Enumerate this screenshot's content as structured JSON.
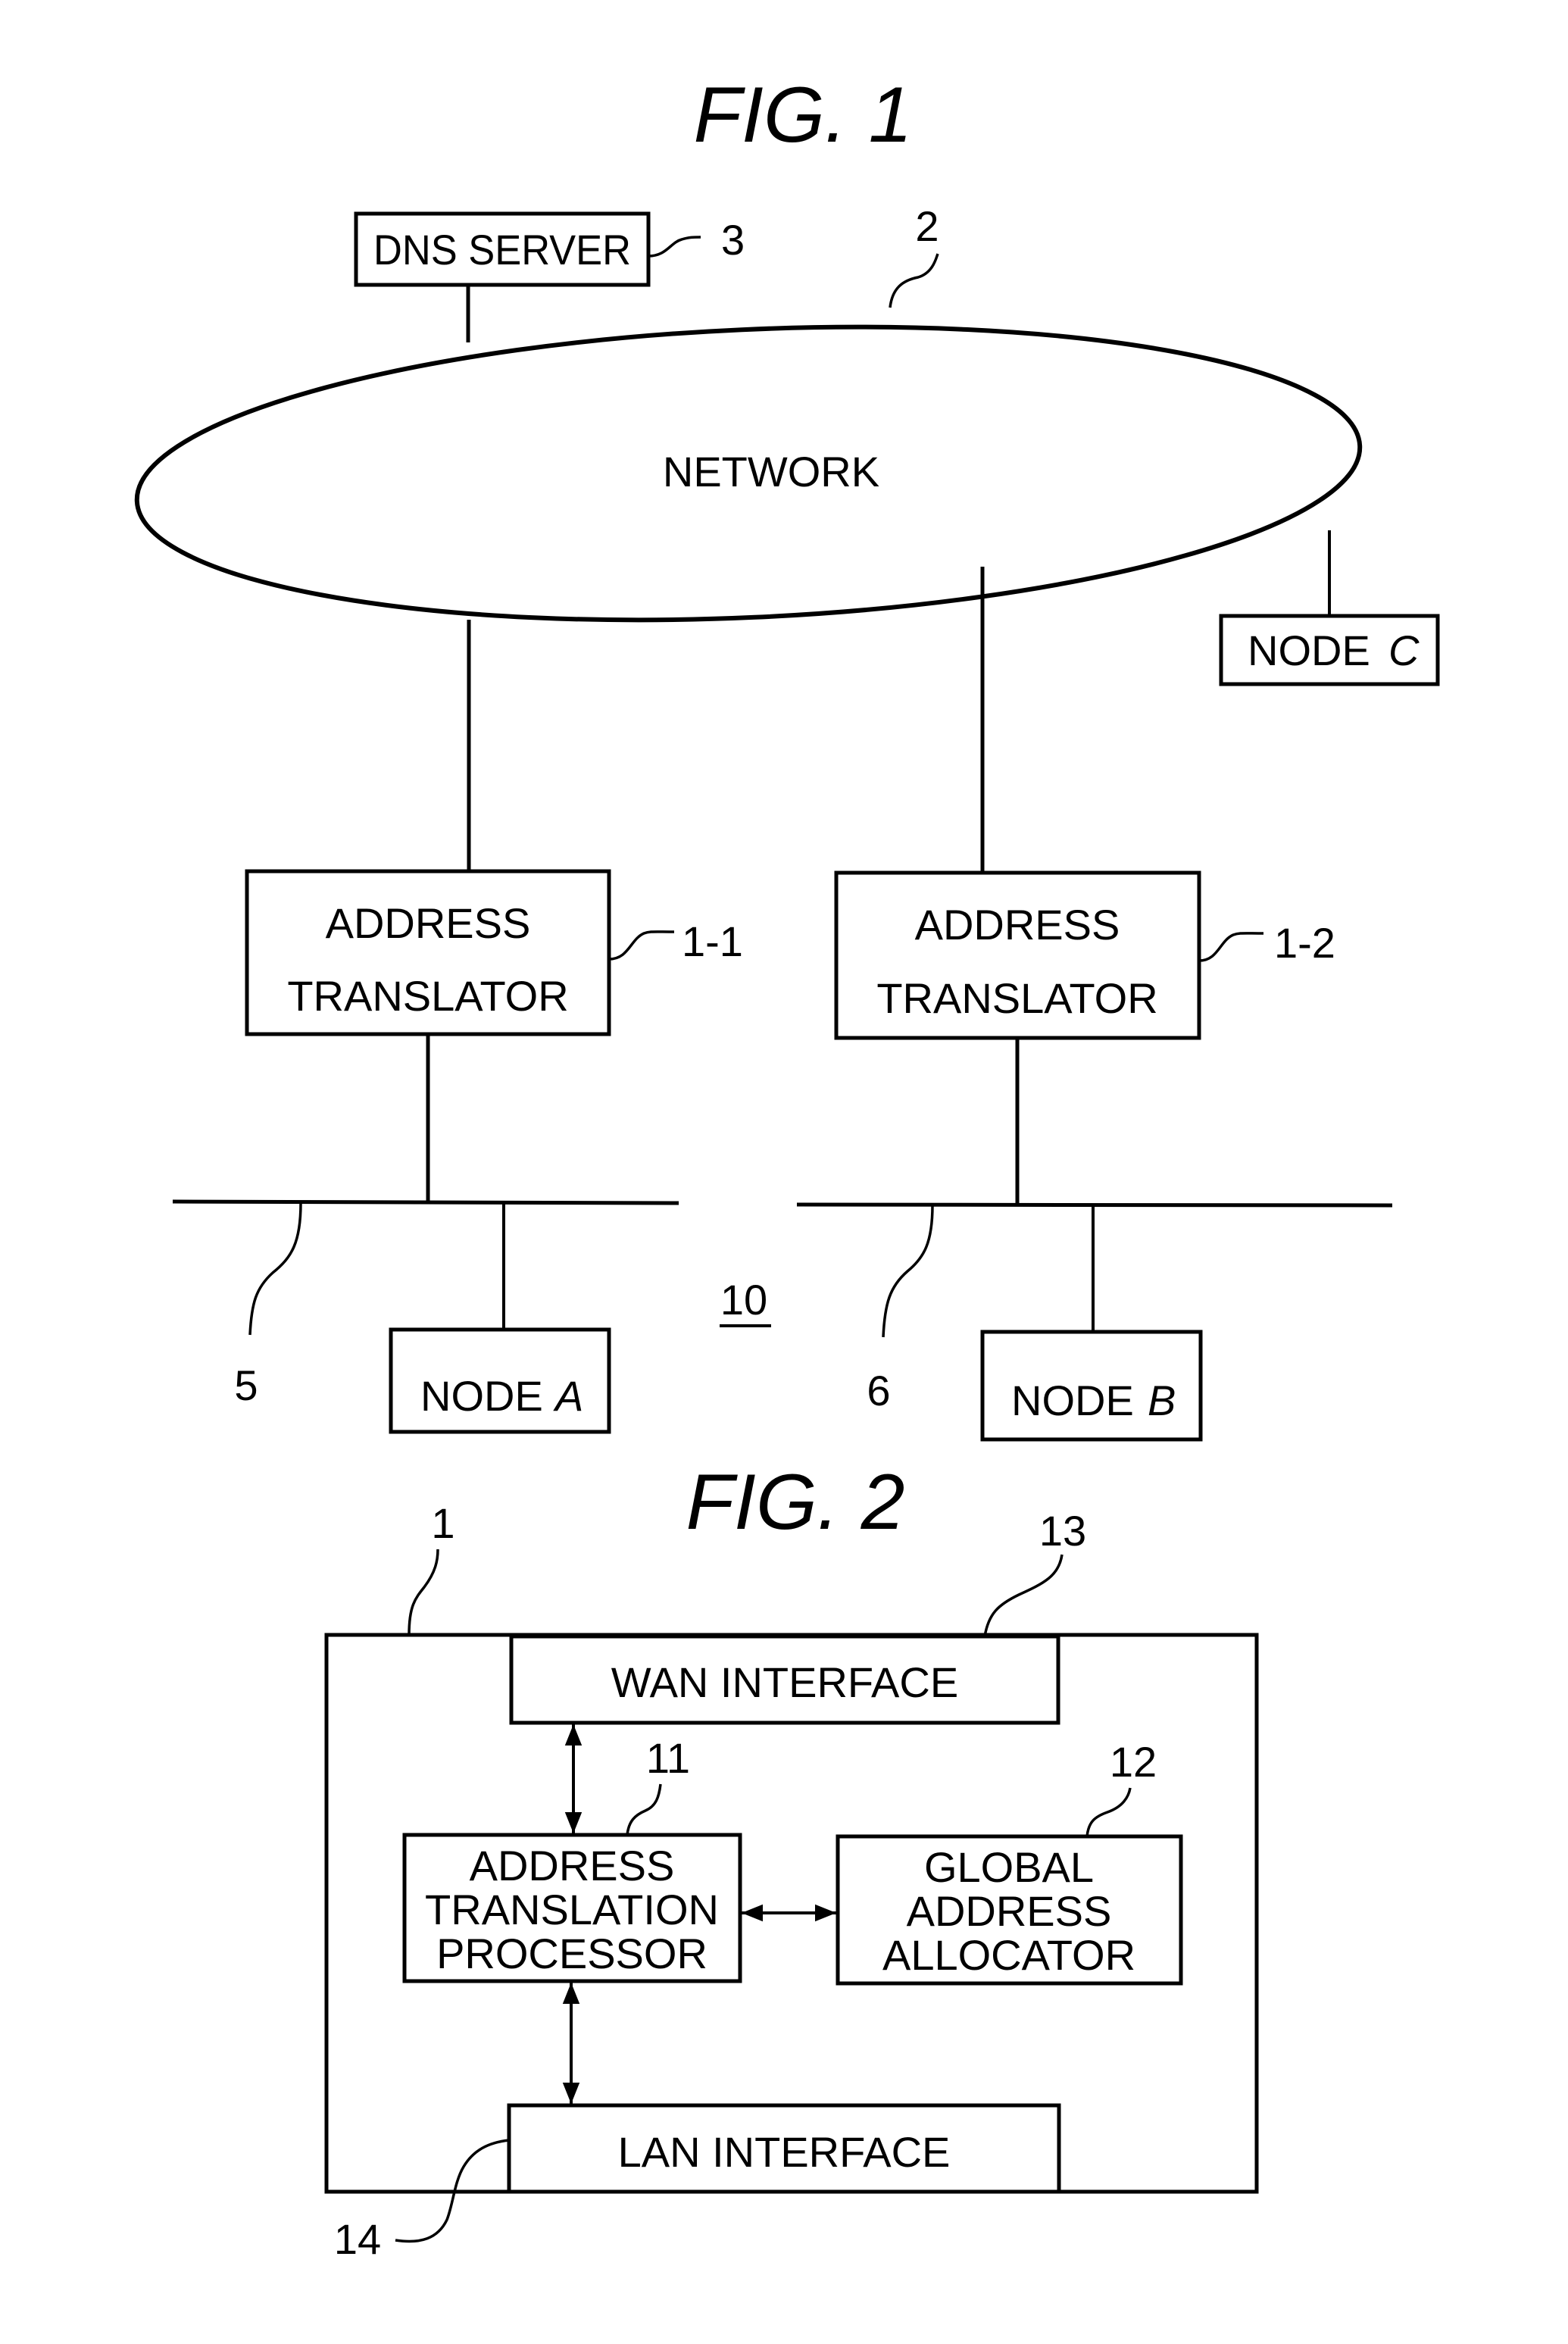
{
  "figure1": {
    "title": "FIG. 1",
    "system_ref": "10",
    "network": {
      "label": "NETWORK",
      "ref": "2"
    },
    "dns_server": {
      "label": "DNS SERVER",
      "ref": "3"
    },
    "node_c": {
      "label": "NODE",
      "letter": "C"
    },
    "translator_1": {
      "line1": "ADDRESS",
      "line2": "TRANSLATOR",
      "ref": "1-1"
    },
    "translator_2": {
      "line1": "ADDRESS",
      "line2": "TRANSLATOR",
      "ref": "1-2"
    },
    "lan_1": {
      "ref": "5"
    },
    "lan_2": {
      "ref": "6"
    },
    "node_a": {
      "label": "NODE",
      "letter": "A"
    },
    "node_b": {
      "label": "NODE",
      "letter": "B"
    }
  },
  "figure2": {
    "title": "FIG. 2",
    "device_ref": "1",
    "wan_interface": {
      "label": "WAN  INTERFACE",
      "ref": "13"
    },
    "processor": {
      "line1": "ADDRESS",
      "line2": "TRANSLATION",
      "line3": "PROCESSOR",
      "ref": "11"
    },
    "allocator": {
      "line1": "GLOBAL",
      "line2": "ADDRESS",
      "line3": "ALLOCATOR",
      "ref": "12"
    },
    "lan_interface": {
      "label": "LAN  INTERFACE",
      "ref": "14"
    }
  }
}
